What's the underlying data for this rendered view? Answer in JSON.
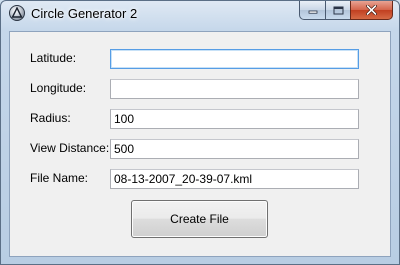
{
  "window": {
    "title": "Circle Generator 2"
  },
  "form": {
    "latitude": {
      "label": "Latitude:",
      "value": ""
    },
    "longitude": {
      "label": "Longitude:",
      "value": ""
    },
    "radius": {
      "label": "Radius:",
      "value": "100"
    },
    "view_distance": {
      "label": "View Distance:",
      "value": "500"
    },
    "file_name": {
      "label": "File Name:",
      "value": "08-13-2007_20-39-07.kml"
    }
  },
  "actions": {
    "create_file_label": "Create File"
  },
  "colors": {
    "focus_border": "#569de5",
    "close_button": "#c13f21",
    "client_background": "#f0f0f0"
  }
}
